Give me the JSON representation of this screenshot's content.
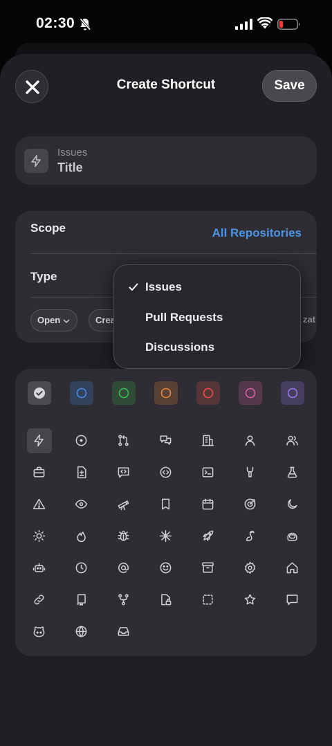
{
  "status": {
    "time": "02:30"
  },
  "header": {
    "title": "Create Shortcut",
    "save_label": "Save"
  },
  "preview": {
    "subtitle": "Issues",
    "title": "Title"
  },
  "settings": {
    "scope_label": "Scope",
    "scope_value": "All Repositories",
    "type_label": "Type",
    "chips": [
      "Open",
      "Crea",
      "zat"
    ]
  },
  "dropdown": {
    "options": [
      "Issues",
      "Pull Requests",
      "Discussions"
    ],
    "selected": "Issues"
  },
  "colors": [
    "#8e8e93",
    "#4b8be8",
    "#3fb950",
    "#e8883a",
    "#e5534b",
    "#db61a2",
    "#9b7bf0"
  ],
  "icons": [
    "zap-icon",
    "issue-open-icon",
    "pull-request-icon",
    "discussion-icon",
    "organization-icon",
    "person-icon",
    "people-icon",
    "briefcase-icon",
    "file-diff-icon",
    "code-review-icon",
    "code-square-icon",
    "terminal-icon",
    "tools-icon",
    "beaker-icon",
    "alert-icon",
    "eye-icon",
    "telescope-icon",
    "bookmark-icon",
    "calendar-icon",
    "goal-icon",
    "moon-icon",
    "sun-icon",
    "flame-icon",
    "bug-icon",
    "sparkle-icon",
    "rocket-icon",
    "squirrel-icon",
    "copilot-icon",
    "robot-icon",
    "clock-icon",
    "mention-icon",
    "smiley-icon",
    "archive-icon",
    "gear-icon",
    "home-icon",
    "link-icon",
    "repo-icon",
    "repo-forked-icon",
    "file-locked-icon",
    "dashed-square-icon",
    "star-icon",
    "comment-icon",
    "octoface-icon",
    "globe-icon",
    "inbox-icon"
  ]
}
